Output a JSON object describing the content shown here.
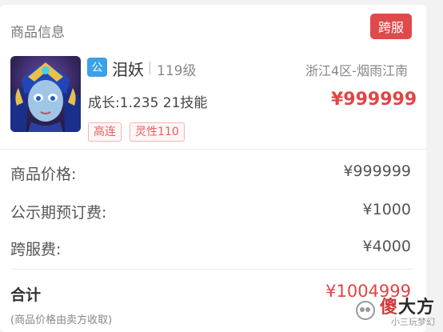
{
  "product": {
    "section_title": "商品信息",
    "cross_server_badge": "跨服",
    "sect_tag": "公",
    "name": "泪妖",
    "level": "119级",
    "server": "浙江4区-烟雨江南",
    "growth_skills": "成长:1.235 21技能",
    "price": "¥999999",
    "tags": [
      "高连",
      "灵性110"
    ]
  },
  "fees": [
    {
      "label": "商品价格:",
      "value": "¥999999"
    },
    {
      "label": "公示期预订费:",
      "value": "¥1000"
    },
    {
      "label": "跨服费:",
      "value": "¥4000"
    }
  ],
  "total": {
    "label": "合计",
    "value": "¥1004999",
    "note": "(商品价格由卖方收取)"
  },
  "watermark": {
    "brand_first": "傻",
    "brand_rest": "大方",
    "sub": "小三玩梦幻"
  },
  "colors": {
    "accent_red": "#e14545",
    "badge_red": "#e04a4a",
    "tag_blue": "#3aa0e8"
  },
  "icons": {
    "avatar": "character-portrait",
    "watermark_logo": "wechat-channel-icon"
  }
}
